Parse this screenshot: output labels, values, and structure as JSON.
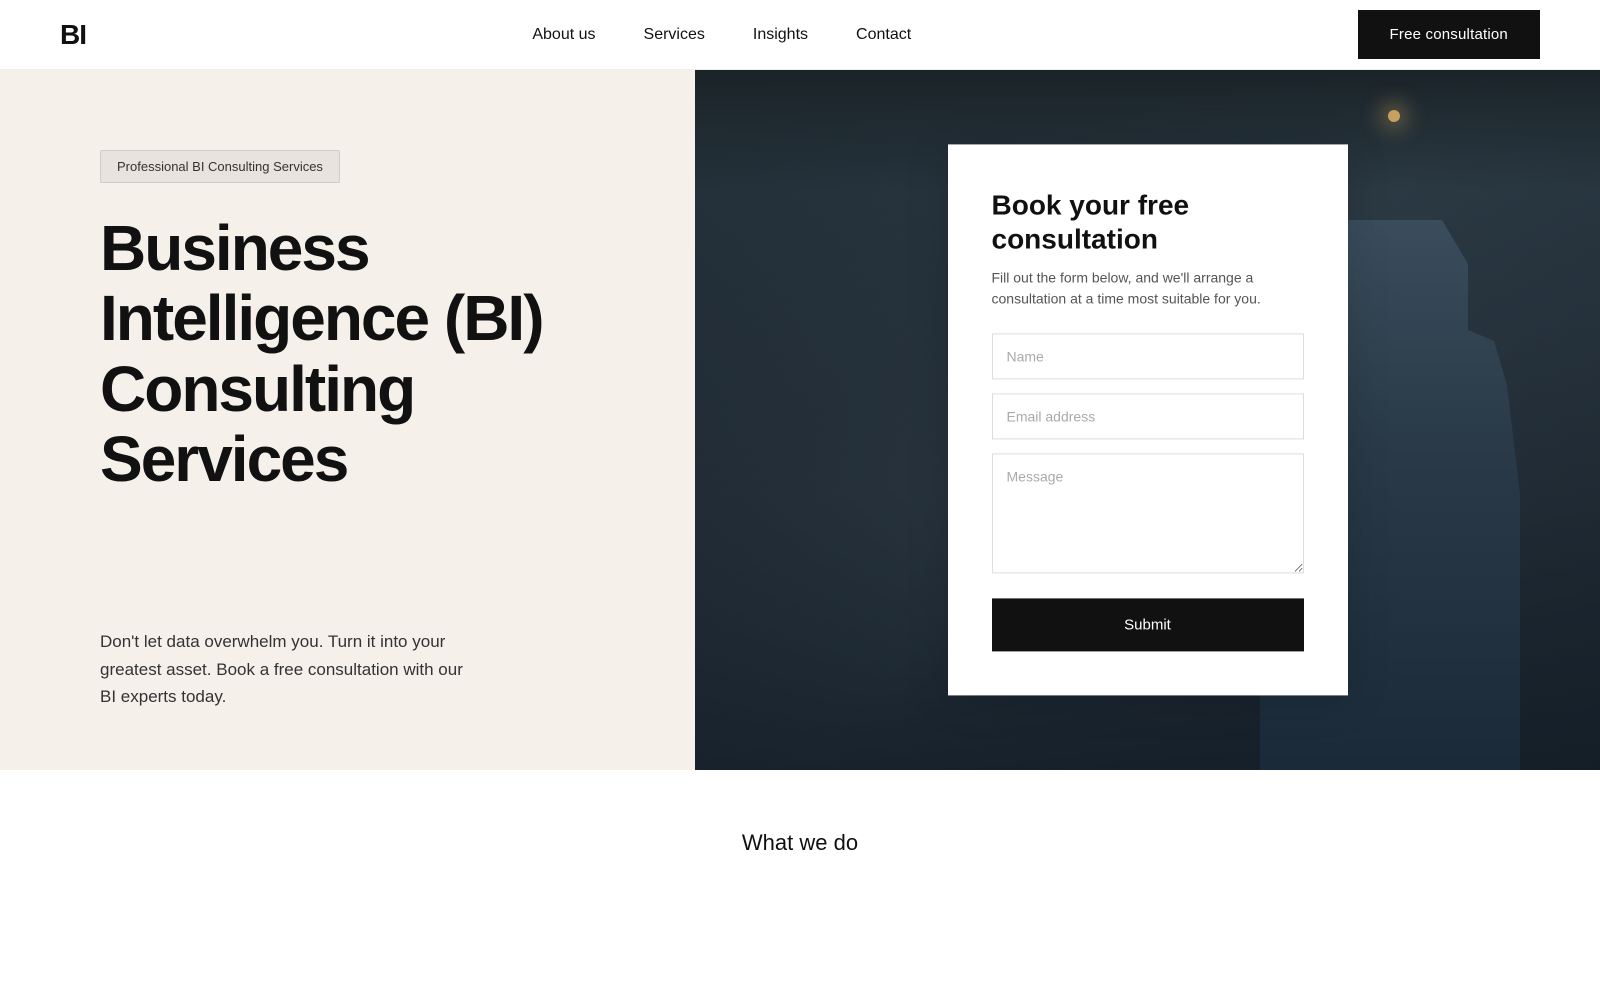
{
  "logo": {
    "text": "BI"
  },
  "navbar": {
    "links": [
      {
        "label": "About us",
        "id": "about-us"
      },
      {
        "label": "Services",
        "id": "services"
      },
      {
        "label": "Insights",
        "id": "insights"
      },
      {
        "label": "Contact",
        "id": "contact"
      }
    ],
    "cta_label": "Free consultation"
  },
  "hero": {
    "badge": "Professional BI Consulting Services",
    "title": "Business Intelligence (BI) Consulting Services",
    "description": "Don't let data overwhelm you. Turn it into your greatest asset. Book a free consultation with our BI experts today."
  },
  "form": {
    "title": "Book your free consultation",
    "description": "Fill out the form below, and we'll arrange a consultation at a time most suitable for you.",
    "name_placeholder": "Name",
    "email_placeholder": "Email address",
    "message_placeholder": "Message",
    "submit_label": "Submit"
  },
  "what_section": {
    "title": "What we do"
  }
}
